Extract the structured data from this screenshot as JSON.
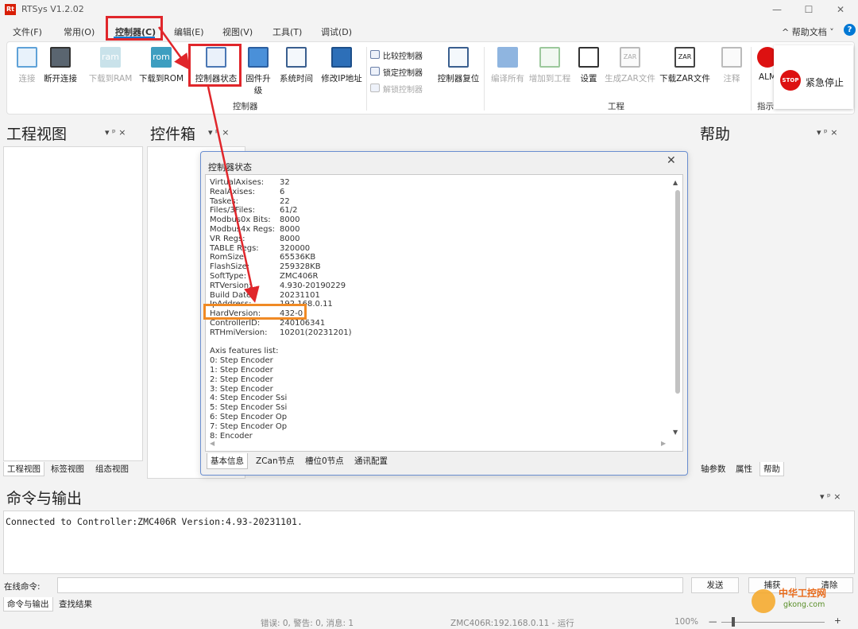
{
  "app": {
    "title": "RTSys V1.2.02",
    "logo": "Rt"
  },
  "window": {
    "minimize": "—",
    "maximize": "☐",
    "close": "✕"
  },
  "menu": [
    "文件(F)",
    "常用(O)",
    "控制器(C)",
    "编辑(E)",
    "视图(V)",
    "工具(T)",
    "调试(D)"
  ],
  "help_doc": "^ 帮助文档 ˅",
  "ribbon": {
    "group1": [
      "连接",
      "断开连接",
      "下载到RAM",
      "下载到ROM",
      "控制器状态",
      "固件升级",
      "系统时间",
      "修改IP地址"
    ],
    "small_cmds": [
      "比较控制器",
      "锁定控制器",
      "解锁控制器"
    ],
    "reset": "控制器复位",
    "group_controller": "控制器",
    "group2": [
      "编译所有",
      "增加到工程",
      "设置",
      "生成ZAR文件",
      "下载ZAR文件",
      "注释"
    ],
    "group_project": "工程",
    "alm": "ALM",
    "group_indicator": "指示",
    "estop": "紧急停止",
    "stop_label": "STOP",
    "ram_label": "ram",
    "rom_label": "rom",
    "zar_label": "ZAR"
  },
  "panels": {
    "project": "工程视图",
    "toolbox": "控件箱",
    "help": "帮助",
    "pin": "▾ ᵖ ×",
    "left_tabs": [
      "工程视图",
      "标签视图",
      "组态视图"
    ],
    "right_tabs": [
      "轴参数",
      "属性",
      "帮助"
    ]
  },
  "dialog": {
    "title": "控制器状态",
    "close": "✕",
    "rows": [
      [
        "VirtualAxises:",
        "32"
      ],
      [
        "RealAxises:",
        "6"
      ],
      [
        "Taskes:",
        "22"
      ],
      [
        "Files/3Files:",
        "61/2"
      ],
      [
        "Modbus0x Bits:",
        "8000"
      ],
      [
        "Modbus4x Regs:",
        "8000"
      ],
      [
        "VR Regs:",
        "8000"
      ],
      [
        "TABLE Regs:",
        "320000"
      ],
      [
        "RomSize:",
        "65536KB"
      ],
      [
        "FlashSize:",
        "259328KB"
      ],
      [
        "SoftType:",
        "ZMC406R"
      ],
      [
        "RTVersion:",
        "4.930-20190229"
      ],
      [
        "Build Date:",
        "20231101"
      ],
      [
        "IpAddress:",
        "192.168.0.11"
      ],
      [
        "HardVersion:",
        "432-0"
      ],
      [
        "ControllerID:",
        "240106341"
      ],
      [
        "RTHmiVersion:",
        "10201(20231201)"
      ]
    ],
    "features_title": "Axis features list:",
    "features": [
      "0: Step Encoder",
      "1: Step Encoder",
      "2: Step Encoder",
      "3: Step Encoder",
      "4: Step Encoder Ssi",
      "5: Step Encoder Ssi",
      "6: Step Encoder Op",
      "7: Step Encoder Op",
      "8: Encoder"
    ],
    "tabs": [
      "基本信息",
      "ZCan节点",
      "槽位0节点",
      "通讯配置"
    ]
  },
  "output": {
    "title": "命令与输出",
    "text": "Connected to Controller:ZMC406R Version:4.93-20231101.",
    "cmd_label": "在线命令:",
    "send": "发送",
    "capture": "捕获",
    "clear": "清除",
    "tabs": [
      "命令与输出",
      "查找结果"
    ]
  },
  "status": {
    "messages": "错误: 0, 警告: 0, 消息: 1",
    "connection": "ZMC406R:192.168.0.11 - 运行",
    "zoom": "100%",
    "minus": "—",
    "plus": "+"
  },
  "watermark": {
    "site": "中华工控网",
    "url": "gkong.com"
  },
  "colors": {
    "highlight_red": "#e0262b",
    "highlight_orange": "#f08a25",
    "accent": "#0078d4"
  }
}
